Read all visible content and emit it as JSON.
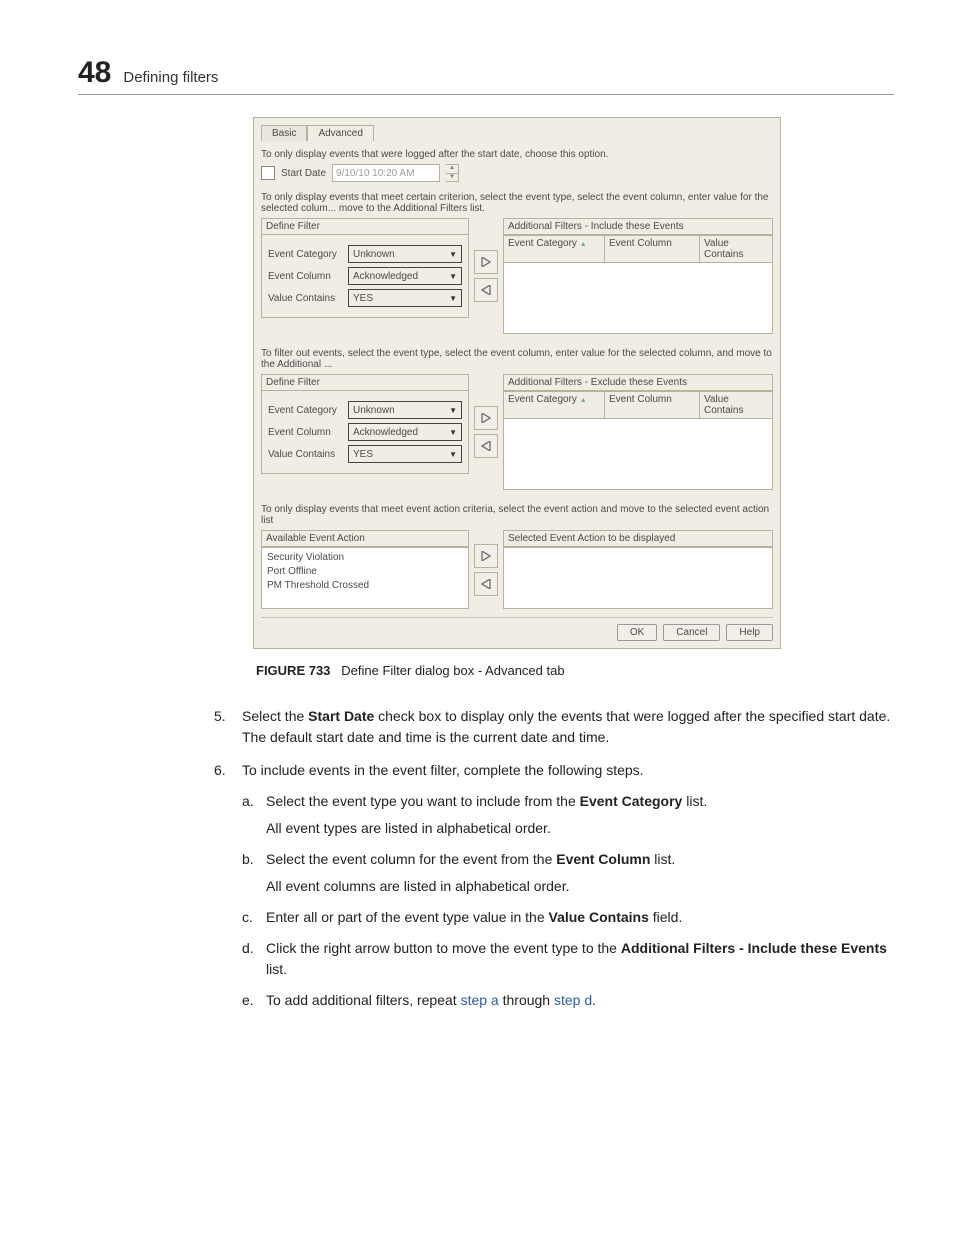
{
  "header": {
    "chapter": "48",
    "title": "Defining filters"
  },
  "dialog": {
    "tabs": {
      "basic": "Basic",
      "advanced": "Advanced"
    },
    "startSection": {
      "desc": "To only display events that were logged after the start date, choose this option.",
      "label": "Start Date",
      "value": "9/10/10 10:20 AM"
    },
    "help1": "To only display events that meet certain criterion, select the event type, select the event column, enter value for the selected colum... move to the Additional Filters list.",
    "defineFilter": "Define Filter",
    "fields": {
      "cat": "Event Category",
      "col": "Event Column",
      "val": "Value Contains",
      "catVal": "Unknown",
      "colVal": "Acknowledged",
      "valVal": "YES"
    },
    "includeTitle": "Additional Filters - Include these Events",
    "th": {
      "cat": "Event Category",
      "col": "Event Column",
      "val": "Value Contains"
    },
    "help2": "To filter out events, select the event type, select the event column, enter value for the selected column, and move to the Additional ...",
    "excludeTitle": "Additional Filters - Exclude these Events",
    "help3": "To only display events that meet event action criteria, select the event action and move to the selected event action list",
    "availActionTitle": "Available Event Action",
    "selActionTitle": "Selected Event Action to be displayed",
    "actions": {
      "a1": "Security Violation",
      "a2": "Port Offline",
      "a3": "PM Threshold Crossed"
    },
    "buttons": {
      "ok": "OK",
      "cancel": "Cancel",
      "help": "Help"
    }
  },
  "caption": {
    "fig": "FIGURE 733",
    "text": "Define Filter dialog box - Advanced tab"
  },
  "step5": {
    "num": "5.",
    "textA": "Select the ",
    "bold": "Start Date",
    "textB": " check box to display only the events that were logged after the specified start date. The default start date and time is the current date and time."
  },
  "step6": {
    "num": "6.",
    "text": "To include events in the event filter, complete the following steps.",
    "a": {
      "let": "a.",
      "t1": "Select the event type you want to include from the ",
      "b": "Event Category",
      "t2": " list.",
      "sub": "All event types are listed in alphabetical order."
    },
    "b": {
      "let": "b.",
      "t1": "Select the event column for the event from the ",
      "b": "Event Column",
      "t2": " list.",
      "sub": "All event columns are listed in alphabetical order."
    },
    "c": {
      "let": "c.",
      "t1": "Enter all or part of the event type value in the ",
      "b": "Value Contains",
      "t2": " field."
    },
    "d": {
      "let": "d.",
      "t1": "Click the right arrow button to move the event type to the ",
      "b": "Additional Filters - Include these Events",
      "t2": " list."
    },
    "e": {
      "let": "e.",
      "t1": "To add additional filters, repeat ",
      "linkA": "step a",
      "t2": " through ",
      "linkD": "step d",
      "t3": "."
    }
  }
}
